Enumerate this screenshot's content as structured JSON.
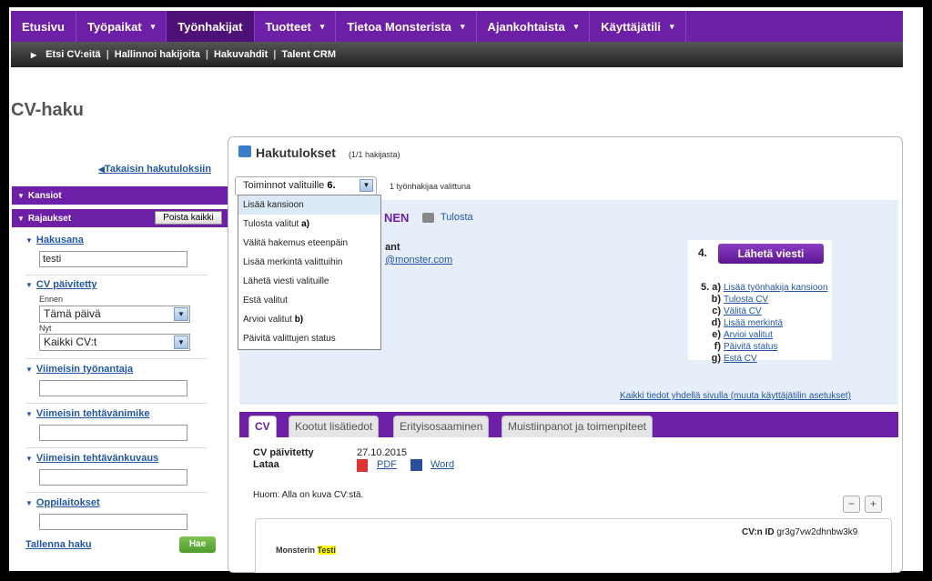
{
  "nav": {
    "items": [
      {
        "label": "Etusivu",
        "dropdown": false,
        "active": false
      },
      {
        "label": "Työpaikat",
        "dropdown": true,
        "active": false
      },
      {
        "label": "Työnhakijat",
        "dropdown": false,
        "active": true
      },
      {
        "label": "Tuotteet",
        "dropdown": true,
        "active": false
      },
      {
        "label": "Tietoa Monsterista",
        "dropdown": true,
        "active": false
      },
      {
        "label": "Ajankohtaista",
        "dropdown": true,
        "active": false
      },
      {
        "label": "Käyttäjätili",
        "dropdown": true,
        "active": false
      }
    ],
    "caret": "▾"
  },
  "subnav": {
    "items": [
      "Etsi CV:eitä",
      "Hallinnoi hakijoita",
      "Hakuvahdit",
      "Talent CRM"
    ],
    "arrow": "▶"
  },
  "page_title": "CV-haku",
  "sidebar": {
    "back_link": "Takaisin hakutuloksiin",
    "folders_header": "Kansiot",
    "filters_header": "Rajaukset",
    "clear_all": "Poista kaikki",
    "keyword_label": "Hakusana",
    "keyword_value": "testi",
    "cv_updated_label": "CV päivitetty",
    "before_label": "Ennen",
    "before_value": "Tämä päivä",
    "now_label": "Nyt",
    "now_value": "Kaikki CV:t",
    "last_employer_label": "Viimeisin työnantaja",
    "last_title_label": "Viimeisin tehtävänimike",
    "last_desc_label": "Viimeisin tehtävänkuvaus",
    "schools_label": "Oppilaitokset",
    "save_search": "Tallenna haku",
    "search_btn": "Hae"
  },
  "results": {
    "title": "Hakutulokset",
    "count": "(1/1 hakijasta)",
    "actions_select": "Toiminnot valituille",
    "marker_6": "6.",
    "selected_note": "1 työnhakijaa valittuna",
    "menu": [
      {
        "label": "Lisää kansioon",
        "marker": ""
      },
      {
        "label": "Tulosta valitut",
        "marker": "a)"
      },
      {
        "label": "Välitä hakemus eteenpäin",
        "marker": ""
      },
      {
        "label": "Lisää merkintä valittuihin",
        "marker": ""
      },
      {
        "label": "Lähetä viesti valituille",
        "marker": ""
      },
      {
        "label": "Estä valitut",
        "marker": ""
      },
      {
        "label": "Arvioi valitut",
        "marker": "b)"
      },
      {
        "label": "Päivitä valittujen status",
        "marker": ""
      }
    ]
  },
  "candidate": {
    "name_fragment": "NEN",
    "print": "Tulosta",
    "role_fragment": "ant",
    "email_fragment": "@monster.com"
  },
  "send": {
    "marker_4": "4.",
    "button": "Lähetä viesti",
    "quick_links": [
      {
        "marker": "5. a)",
        "label": "Lisää työnhakija kansioon"
      },
      {
        "marker": "b)",
        "label": "Tulosta CV"
      },
      {
        "marker": "c)",
        "label": "Välitä CV"
      },
      {
        "marker": "d)",
        "label": "Lisää merkintä"
      },
      {
        "marker": "e)",
        "label": "Arvioi valitut"
      },
      {
        "marker": "f)",
        "label": "Päivitä status"
      },
      {
        "marker": "g)",
        "label": "Estä CV"
      }
    ]
  },
  "all_info_link": "Kaikki tiedot yhdellä sivulla (muuta käyttäjätilin asetukset)",
  "tabs": [
    "CV",
    "Kootut lisätiedot",
    "Erityisosaaminen",
    "Muistiinpanot ja toimenpiteet"
  ],
  "cv": {
    "updated_label": "CV päivitetty",
    "download_label": "Lataa",
    "updated_date": "27.10.2015",
    "pdf": "PDF",
    "word": "Word",
    "note": "Huom: Alla on kuva CV:stä.",
    "id_label": "CV:n ID",
    "id_value": "gr3g7vw2dhnbw3k9",
    "preview_text": "Monsterin",
    "preview_highlight": "Testi"
  },
  "colors": {
    "brand": "#6d1fa8",
    "link": "#2356a4"
  }
}
